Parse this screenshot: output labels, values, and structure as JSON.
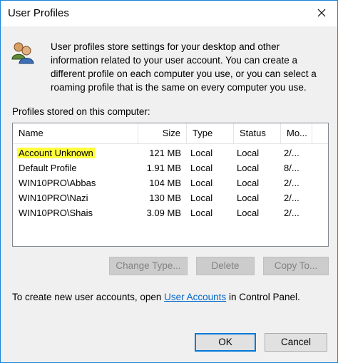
{
  "window": {
    "title": "User Profiles"
  },
  "intro_text": "User profiles store settings for your desktop and other information related to your user account. You can create a different profile on each computer you use, or you can select a roaming profile that is the same on every computer you use.",
  "profiles_label": "Profiles stored on this computer:",
  "columns": {
    "name": "Name",
    "size": "Size",
    "type": "Type",
    "status": "Status",
    "modified": "Mo..."
  },
  "rows": [
    {
      "name": "Account Unknown",
      "size": "121 MB",
      "type": "Local",
      "status": "Local",
      "modified": "2/..."
    },
    {
      "name": "Default Profile",
      "size": "1.91 MB",
      "type": "Local",
      "status": "Local",
      "modified": "8/..."
    },
    {
      "name": "WIN10PRO\\Abbas",
      "size": "104 MB",
      "type": "Local",
      "status": "Local",
      "modified": "2/..."
    },
    {
      "name": "WIN10PRO\\Nazi",
      "size": "130 MB",
      "type": "Local",
      "status": "Local",
      "modified": "2/..."
    },
    {
      "name": "WIN10PRO\\Shais",
      "size": "3.09 MB",
      "type": "Local",
      "status": "Local",
      "modified": "2/..."
    }
  ],
  "buttons": {
    "change_type": "Change Type...",
    "delete": "Delete",
    "copy_to": "Copy To...",
    "ok": "OK",
    "cancel": "Cancel"
  },
  "footer": {
    "prefix": "To create new user accounts, open ",
    "link": "User Accounts",
    "suffix": " in Control Panel."
  },
  "colors": {
    "highlight": "#ffff3b",
    "link": "#0066cc",
    "window_border": "#1883d7"
  },
  "icons": {
    "users": "users-icon",
    "close": "close-icon"
  }
}
